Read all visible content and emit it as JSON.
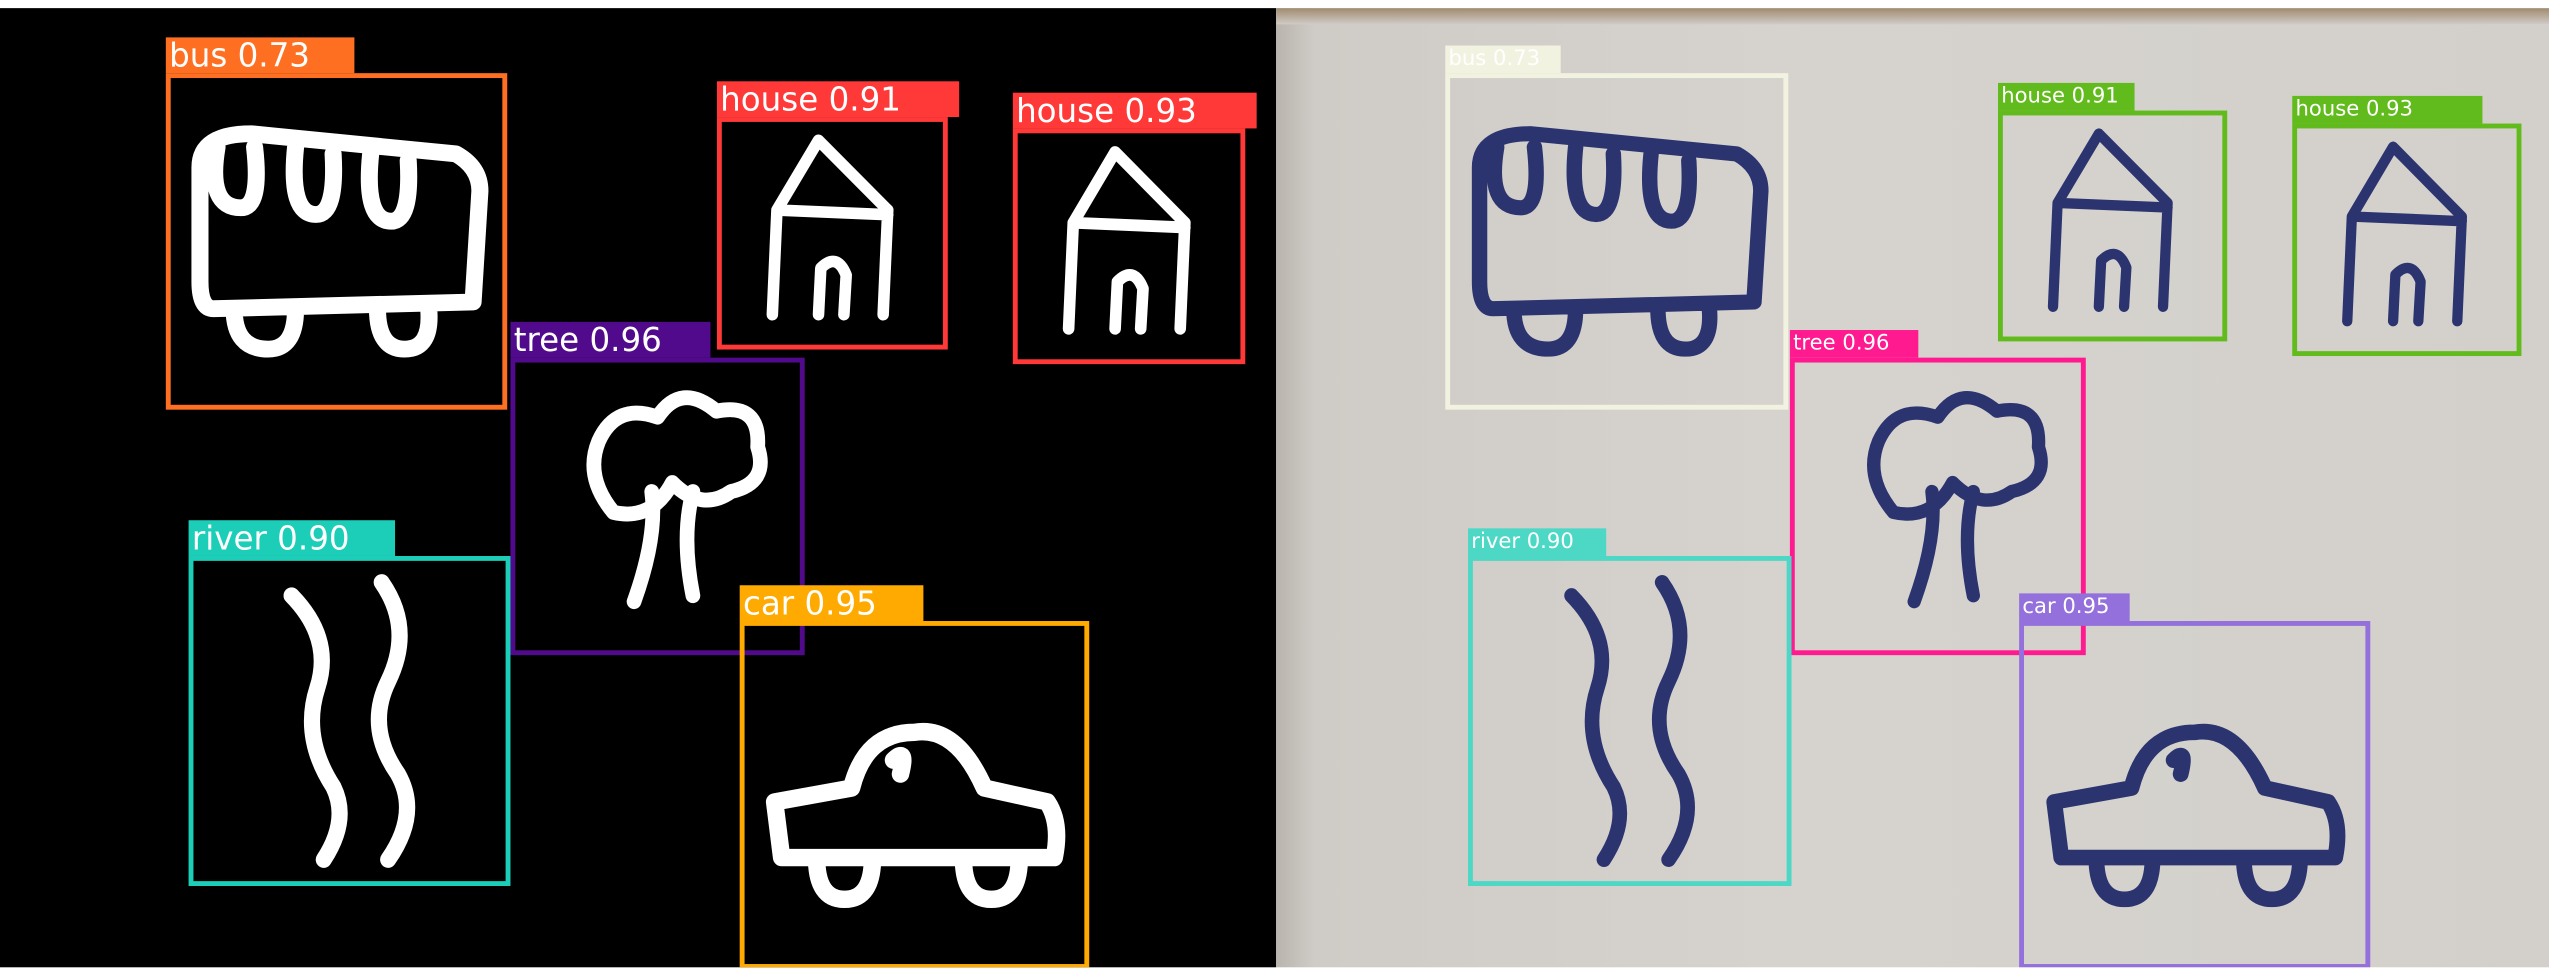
{
  "panels": {
    "left": {
      "view": "binary-mask",
      "detections": [
        {
          "label": "bus",
          "score": "0.73",
          "color": "#ff6f22"
        },
        {
          "label": "house",
          "score": "0.91",
          "color": "#ff3838"
        },
        {
          "label": "house",
          "score": "0.93",
          "color": "#ff3838"
        },
        {
          "label": "tree",
          "score": "0.96",
          "color": "#520a8c"
        },
        {
          "label": "river",
          "score": "0.90",
          "color": "#1ccdb8"
        },
        {
          "label": "car",
          "score": "0.95",
          "color": "#ffaa00"
        }
      ]
    },
    "right": {
      "view": "camera-photo",
      "detections": [
        {
          "label": "bus",
          "score": "0.73",
          "color": "#f2f2e0"
        },
        {
          "label": "house",
          "score": "0.91",
          "color": "#62bb1c"
        },
        {
          "label": "house",
          "score": "0.93",
          "color": "#62bb1c"
        },
        {
          "label": "tree",
          "score": "0.96",
          "color": "#ff1a8f"
        },
        {
          "label": "river",
          "score": "0.90",
          "color": "#4dd8c6"
        },
        {
          "label": "car",
          "score": "0.95",
          "color": "#9370db"
        }
      ]
    }
  }
}
